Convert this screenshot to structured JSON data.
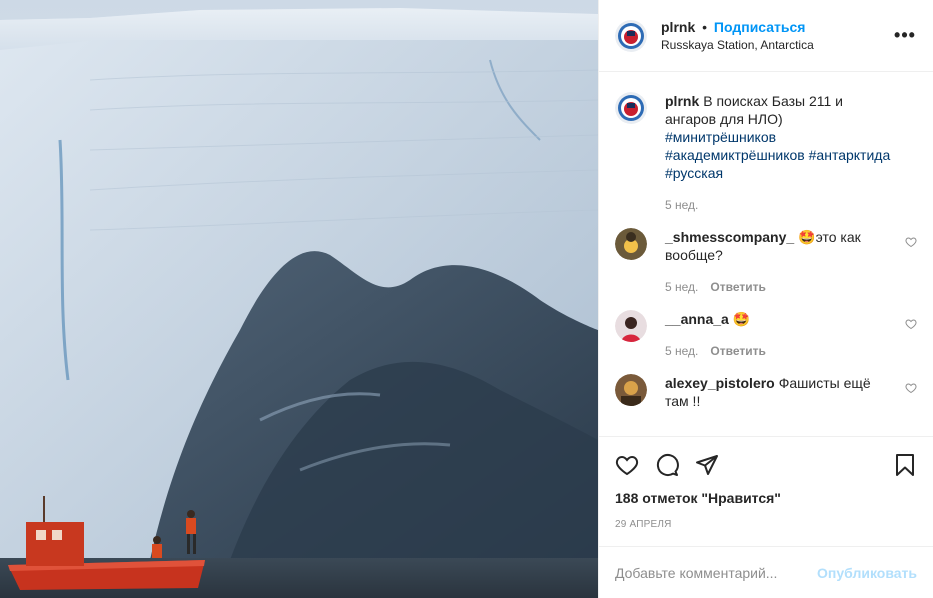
{
  "post": {
    "username": "plrnk",
    "separator": "•",
    "follow_label": "Подписаться",
    "location": "Russkaya Station, Antarctica",
    "more_icon": "more-options-icon",
    "more_label": "•••"
  },
  "comments": [
    {
      "user": "plrnk",
      "text": "В поисках Базы 211 и ангаров для НЛО)",
      "hashtags": [
        "#минитрёшников",
        "#академиктрёшников",
        "#антарктида",
        "#русская"
      ],
      "time": "5 нед.",
      "reply": ""
    },
    {
      "user": "_shmesscompany_",
      "text": "🤩это как вообще?",
      "time": "5 нед.",
      "reply": "Ответить"
    },
    {
      "user": "__anna_a",
      "text": "🤩",
      "time": "5 нед.",
      "reply": "Ответить"
    },
    {
      "user": "alexey_pistolero",
      "text": "Фашисты ещё там !!",
      "time": "",
      "reply": ""
    }
  ],
  "actions": {
    "like_icon": "heart-icon",
    "comment_icon": "comment-icon",
    "share_icon": "share-icon",
    "save_icon": "bookmark-icon"
  },
  "likes": "188 отметок \"Нравится\"",
  "date": "29 АПРЕЛЯ",
  "add_comment": {
    "placeholder": "Добавьте комментарий...",
    "publish_label": "Опубликовать"
  },
  "colors": {
    "link": "#0095f6",
    "publish_disabled": "#b2dffc",
    "muted": "#8e8e8e"
  }
}
